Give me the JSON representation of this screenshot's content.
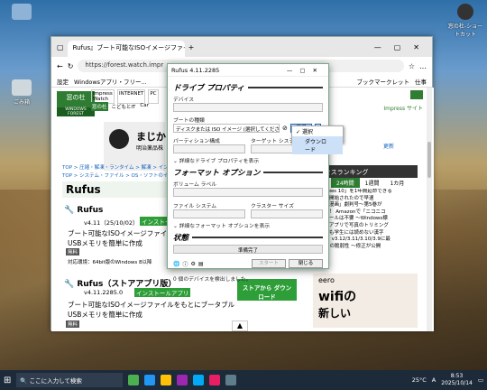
{
  "desktop": {
    "icons": [
      {
        "label": "ごみ箱"
      },
      {
        "label": "窓の杜-ショートカット"
      }
    ],
    "recycle_top_label": "ごみ箱"
  },
  "browser": {
    "tab_title": "Rufus』ブート可能なISOイメージファイ",
    "url": "https://forest.watch.impr",
    "fav_settings": "設定",
    "fav_items": [
      "Windowsアプリ・フリー...",
      "ブックマークレット",
      "仕事"
    ],
    "site": {
      "logo": "窓の杜",
      "brand": "WINDOWS FOREST",
      "nav_top": [
        "Impress Watch",
        "INTERNET",
        "PC"
      ],
      "nav_bottom": [
        "窓の杜",
        "こどもとIT",
        "Car"
      ],
      "ad_name": "まじか",
      "ad_sub": "明治薬品株",
      "impress_site": "Impress サイト",
      "breadcrumbs": [
        "TOP > 圧縮・解凍・ランタイム > 解凍 > インストール",
        "TOP > システム・ファイル > OS・ソフトのインストール"
      ],
      "heading": "Rufus",
      "apps": [
        {
          "name": "Rufus",
          "version": "v4.11（25/10/02）",
          "badge": "インストール不要",
          "desc1": "ブート可能なISOイメージファイル",
          "desc2": "USBメモリを簡単に作成",
          "tag": "無料",
          "os": "対応環境：64bit版のWindows 8以降"
        },
        {
          "name": "Rufus（ストアアプリ版）",
          "version": "v4.11.2285.0",
          "badge": "インストールアプリ",
          "desc1": "ブート可能なISOイメージファイルをもとにブータブル",
          "desc2": "USBメモリを簡単に作成",
          "tag": "無料"
        }
      ],
      "store_btn": "ストアから ダウンロード",
      "ranking_title": "アクセスランキング",
      "ranking_tabs": [
        "24時間",
        "1週間",
        "1カ月"
      ],
      "ranking_items": [
        "「Windows 10」を1年間延命できる",
        "の登録が開始されたので早速",
        "ンチョコ漫画」劇判号〜第5巻が",
        "特別価格！ Amazonで「ニコニコ",
        "ア分析ツールは不要 〜Windows標",
        "eNote」アプリで写真のトリミング",
        "る子供でも学生には読めない漢字",
        "Python」v3.12/3.11/3.10/3.9に最",
        "-Fで8GHの脆弱性 〜修正が公開"
      ],
      "ad_eero": "eero",
      "ad_wifi": "wifiの",
      "ad_shinshii": "新しい",
      "update_label": "更新"
    }
  },
  "rufus": {
    "title": "Rufus 4.11.2285",
    "drive_section": "ドライブ プロパティ",
    "device_label": "デバイス",
    "device_value": "",
    "boot_label": "ブートの種類",
    "boot_value": "ディスクまたは ISO イメージ (選択してください)",
    "select_btn": "選択",
    "partition_label": "パーティション構成",
    "target_label": "ターゲット システム",
    "advanced_drive": "詳細なドライブ プロパティを表示",
    "format_section": "フォーマット オプション",
    "volume_label": "ボリューム ラベル",
    "fs_label": "ファイル システム",
    "cluster_label": "クラスター サイズ",
    "advanced_format": "詳細なフォーマット オプションを表示",
    "status_section": "状態",
    "status_text": "準備完了",
    "start_btn": "スタート",
    "close_btn": "閉じる",
    "footer": "0 個のデバイスを検出しました。",
    "dropdown": [
      "選択",
      "ダウンロード"
    ]
  },
  "taskbar": {
    "search_placeholder": "ここに入力して検索",
    "weather": "25°C",
    "ime": "A",
    "time": "8:53",
    "date": "2025/10/14"
  }
}
